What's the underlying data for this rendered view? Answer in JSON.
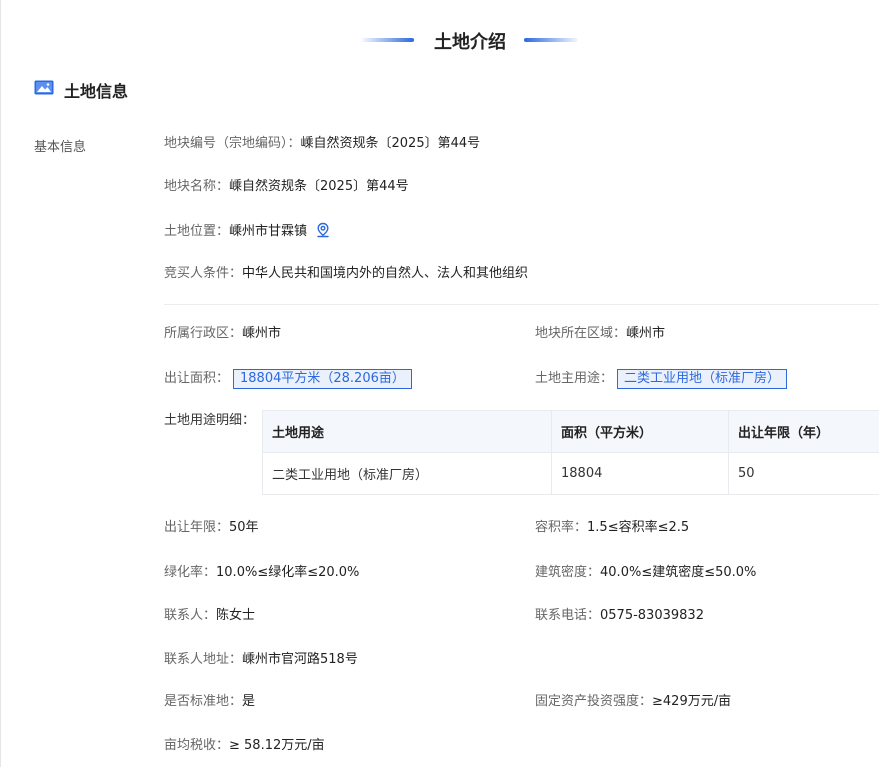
{
  "header": {
    "title": "土地介绍"
  },
  "section": {
    "title": "土地信息"
  },
  "basic_label": "基本信息",
  "basic": {
    "plot_number": {
      "label": "地块编号（宗地编码）：",
      "value": "嵊自然资规条〔2025〕第44号"
    },
    "plot_name": {
      "label": "地块名称：",
      "value": "嵊自然资规条〔2025〕第44号"
    },
    "location": {
      "label": "土地位置：",
      "value": "嵊州市甘霖镇"
    },
    "bidder": {
      "label": "竞买人条件：",
      "value": "中华人民共和国境内外的自然人、法人和其他组织"
    }
  },
  "details": {
    "admin_region": {
      "label": "所属行政区：",
      "value": "嵊州市"
    },
    "plot_region": {
      "label": "地块所在区域：",
      "value": "嵊州市"
    },
    "area": {
      "label": "出让面积：",
      "value": "18804平方米（28.206亩）"
    },
    "main_use": {
      "label": "土地主用途：",
      "value": "二类工业用地（标准厂房）"
    },
    "use_detail_label": "土地用途明细：",
    "table": {
      "headers": [
        "土地用途",
        "面积（平方米）",
        "出让年限（年）"
      ],
      "rows": [
        [
          "二类工业用地（标准厂房）",
          "18804",
          "50"
        ]
      ]
    },
    "term": {
      "label": "出让年限：",
      "value": "50年"
    },
    "far": {
      "label": "容积率：",
      "value": "1.5≤容积率≤2.5"
    },
    "green": {
      "label": "绿化率：",
      "value": "10.0%≤绿化率≤20.0%"
    },
    "density": {
      "label": "建筑密度：",
      "value": "40.0%≤建筑密度≤50.0%"
    },
    "contact": {
      "label": "联系人：",
      "value": "陈女士"
    },
    "phone": {
      "label": "联系电话：",
      "value": "0575-83039832"
    },
    "address": {
      "label": "联系人地址：",
      "value": "嵊州市官河路518号"
    },
    "standard": {
      "label": "是否标准地：",
      "value": "是"
    },
    "investment": {
      "label": "固定资产投资强度：",
      "value": "≥429万元/亩"
    },
    "tax": {
      "label": "亩均税收：",
      "value": "≥ 58.12万元/亩"
    }
  },
  "icons": {
    "section": "image-icon",
    "location": "location-pin-icon"
  },
  "colors": {
    "accent": "#2c68de"
  }
}
